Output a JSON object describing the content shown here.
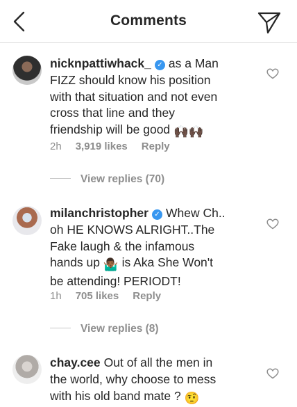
{
  "header": {
    "title": "Comments",
    "back_icon": "chevron-left-icon",
    "send_icon": "send-icon"
  },
  "comments": [
    {
      "username": "nicknpattiwhack_",
      "verified": true,
      "text_lines": [
        "as a Man",
        "FIZZ should know his position",
        "with that situation and not even",
        "cross that line and they",
        "friendship will be good"
      ],
      "emoji": "🙌🏿🙌🏿",
      "time": "2h",
      "likes": "3,919 likes",
      "reply": "Reply",
      "view_replies": "View replies (70)"
    },
    {
      "username": "milanchristopher",
      "verified": true,
      "text_lines": [
        "Whew Ch..",
        "oh HE KNOWS ALRIGHT..The",
        "Fake laugh & the infamous",
        "hands up",
        "is Aka She Won't",
        "be attending! PERIODT!"
      ],
      "emoji": "🤷🏾‍♂️",
      "time": "1h",
      "likes": "705 likes",
      "reply": "Reply",
      "view_replies": "View replies (8)"
    },
    {
      "username": "chay.cee",
      "verified": false,
      "text_lines": [
        "Out of all the men in",
        "the world, why choose to mess",
        "with his old band mate ?"
      ],
      "emoji": "🤨"
    }
  ],
  "colors": {
    "text": "#262626",
    "meta": "#8e8e8e",
    "verified": "#3897f0",
    "divider": "#dbdbdb"
  }
}
